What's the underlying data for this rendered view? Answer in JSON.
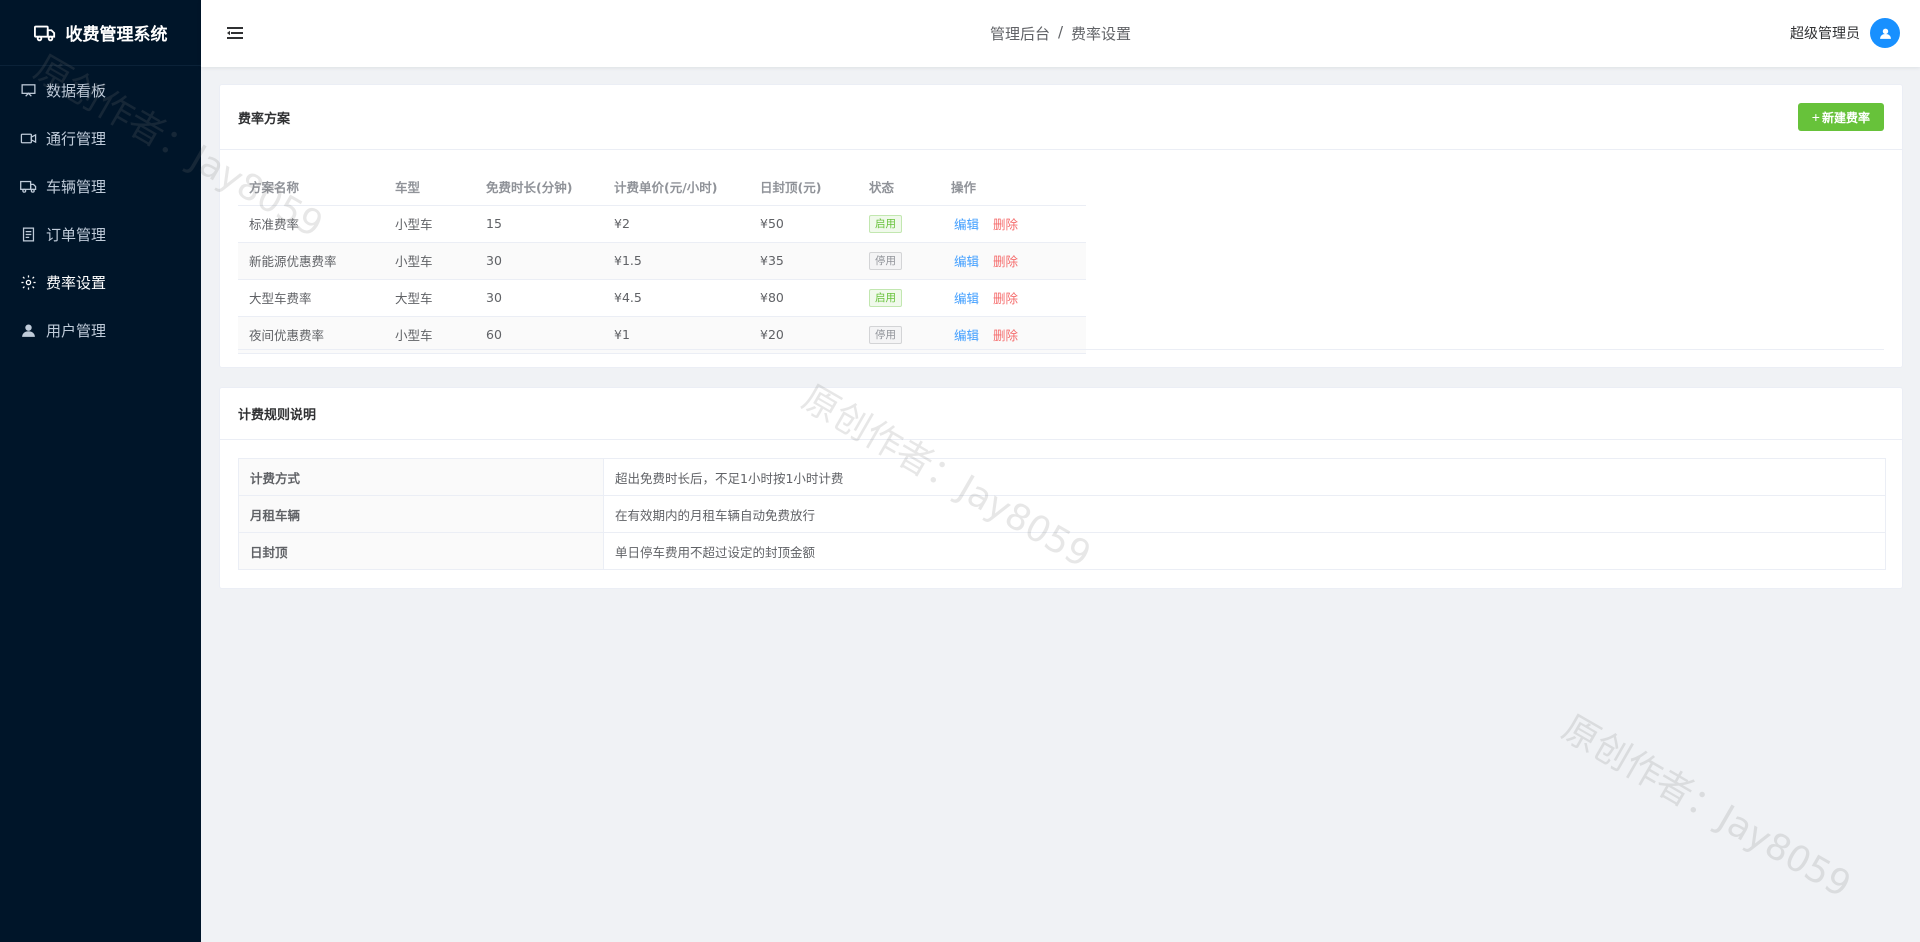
{
  "brand": {
    "title": "收费管理系统",
    "icon": "truck-icon"
  },
  "sidebar": {
    "items": [
      {
        "label": "数据看板",
        "icon": "presentation-icon",
        "active": false
      },
      {
        "label": "通行管理",
        "icon": "video-camera-icon",
        "active": false
      },
      {
        "label": "车辆管理",
        "icon": "truck-icon",
        "active": false
      },
      {
        "label": "订单管理",
        "icon": "document-icon",
        "active": false
      },
      {
        "label": "费率设置",
        "icon": "gear-icon",
        "active": true
      },
      {
        "label": "用户管理",
        "icon": "user-icon",
        "active": false
      }
    ]
  },
  "header": {
    "breadcrumb": [
      "管理后台",
      "费率设置"
    ],
    "separator": "/",
    "username": "超级管理员"
  },
  "rate_card": {
    "title": "费率方案",
    "new_button": "新建费率",
    "new_button_icon": "+",
    "columns": [
      "方案名称",
      "车型",
      "免费时长(分钟)",
      "计费单价(元/小时)",
      "日封顶(元)",
      "状态",
      "操作"
    ],
    "rows": [
      {
        "name": "标准费率",
        "type": "小型车",
        "free": "15",
        "price": "¥2",
        "cap": "¥50",
        "status": "启用",
        "enabled": true
      },
      {
        "name": "新能源优惠费率",
        "type": "小型车",
        "free": "30",
        "price": "¥1.5",
        "cap": "¥35",
        "status": "停用",
        "enabled": false
      },
      {
        "name": "大型车费率",
        "type": "大型车",
        "free": "30",
        "price": "¥4.5",
        "cap": "¥80",
        "status": "启用",
        "enabled": true
      },
      {
        "name": "夜间优惠费率",
        "type": "小型车",
        "free": "60",
        "price": "¥1",
        "cap": "¥20",
        "status": "停用",
        "enabled": false
      }
    ],
    "edit_label": "编辑",
    "delete_label": "删除"
  },
  "rules_card": {
    "title": "计费规则说明",
    "rows": [
      {
        "key": "计费方式",
        "value": "超出免费时长后，不足1小时按1小时计费"
      },
      {
        "key": "月租车辆",
        "value": "在有效期内的月租车辆自动免费放行"
      },
      {
        "key": "日封顶",
        "value": "单日停车费用不超过设定的封顶金额"
      }
    ]
  },
  "watermark": "原创作者：Jay8059",
  "colors": {
    "sidebar_bg": "#001529",
    "accent": "#1890ff",
    "success": "#67c23a",
    "danger": "#f56c6c",
    "link": "#409eff"
  }
}
